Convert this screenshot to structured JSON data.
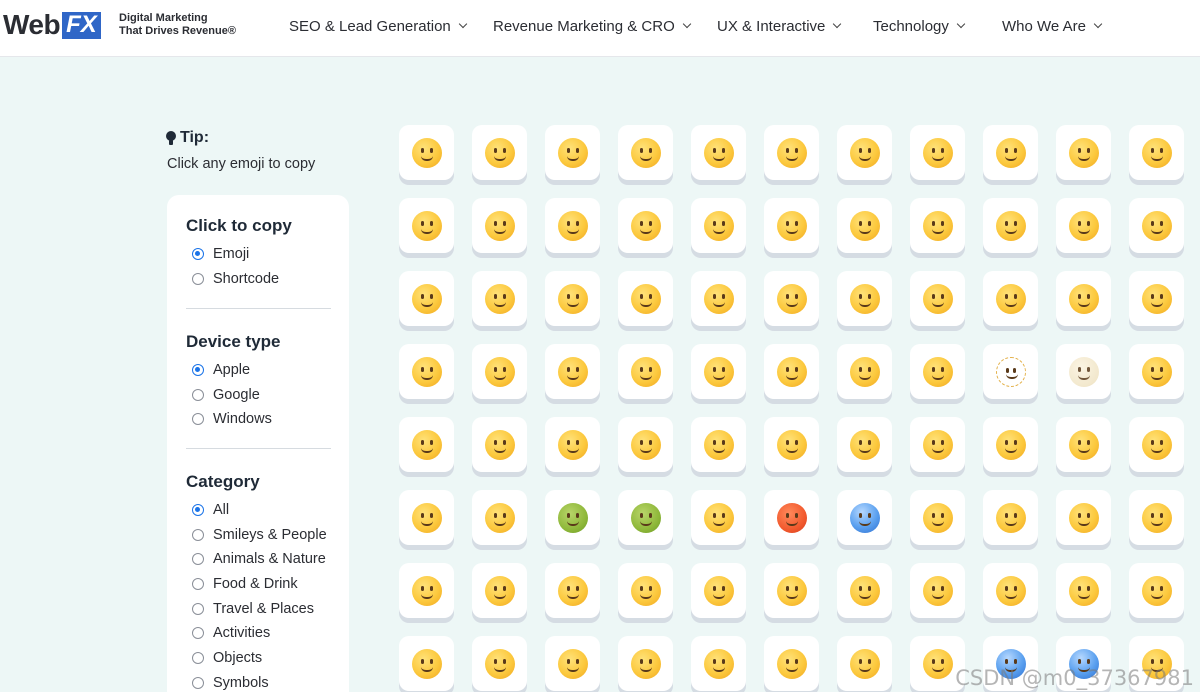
{
  "header": {
    "logo_web": "Web",
    "logo_fx": "FX",
    "tagline_line1": "Digital Marketing",
    "tagline_line2": "That Drives Revenue®",
    "nav": [
      {
        "label": "SEO & Lead Generation"
      },
      {
        "label": "Revenue Marketing & CRO"
      },
      {
        "label": "UX & Interactive"
      },
      {
        "label": "Technology"
      },
      {
        "label": "Who We Are"
      }
    ]
  },
  "tip": {
    "title": "Tip:",
    "text": "Click any emoji to copy"
  },
  "filters": {
    "copy": {
      "title": "Click to copy",
      "options": [
        "Emoji",
        "Shortcode"
      ],
      "selected": "Emoji"
    },
    "device": {
      "title": "Device type",
      "options": [
        "Apple",
        "Google",
        "Windows"
      ],
      "selected": "Apple"
    },
    "category": {
      "title": "Category",
      "options": [
        "All",
        "Smileys & People",
        "Animals & Nature",
        "Food & Drink",
        "Travel & Places",
        "Activities",
        "Objects",
        "Symbols"
      ],
      "selected": "All"
    }
  },
  "emoji_rows": [
    [
      "😀",
      "😃",
      "😄",
      "😁",
      "😆",
      "😅",
      "🤣",
      "😂",
      "🙂",
      "🙃",
      "🫠"
    ],
    [
      "😉",
      "😊",
      "😇",
      "🥰",
      "😍",
      "🤩",
      "😘",
      "😗",
      "☺️",
      "😚",
      "😙"
    ],
    [
      "🥲",
      "😋",
      "😛",
      "😜",
      "🤪",
      "😝",
      "🤑",
      "🤗",
      "🤭",
      "🫢",
      "🫣"
    ],
    [
      "🤫",
      "🤔",
      "🫡",
      "🤐",
      "🤨",
      "😐",
      "😑",
      "😶",
      "🫥",
      "😶‍🌫️",
      "😏"
    ],
    [
      "😒",
      "🙄",
      "😬",
      "😮‍💨",
      "🤥",
      "😌",
      "😔",
      "😪",
      "🤤",
      "😴",
      "😷"
    ],
    [
      "🤒",
      "🤕",
      "🤢",
      "🤮",
      "🤧",
      "🥵",
      "🥶",
      "🥴",
      "😵",
      "😵‍💫",
      "🤯"
    ],
    [
      "🤠",
      "🥳",
      "🥸",
      "😎",
      "🤓",
      "🧐",
      "😕",
      "🫤",
      "😟",
      "🙁",
      "☹️"
    ],
    [
      "😮",
      "😯",
      "😲",
      "😳",
      "🥺",
      "🥹",
      "😦",
      "😧",
      "😨",
      "😰",
      "😥"
    ]
  ],
  "watermark": "CSDN @m0_37367981"
}
